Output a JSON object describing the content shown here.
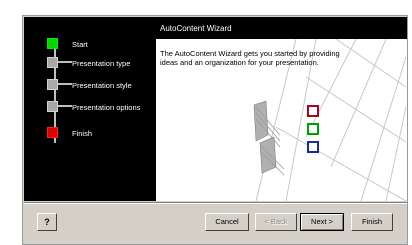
{
  "wizard": {
    "title": "AutoContent Wizard",
    "description": "The AutoContent Wizard gets you started by providing ideas and an organization for your presentation.",
    "steps": [
      {
        "label": "Start",
        "state": "current",
        "color": "#00d800"
      },
      {
        "label": "Presentation type",
        "state": "pending",
        "color": "#a8a8a8"
      },
      {
        "label": "Presentation style",
        "state": "pending",
        "color": "#a8a8a8"
      },
      {
        "label": "Presentation options",
        "state": "pending",
        "color": "#a8a8a8"
      },
      {
        "label": "Finish",
        "state": "end",
        "color": "#e00000"
      }
    ],
    "decoration_squares": [
      "red",
      "green",
      "blue"
    ]
  },
  "buttons": {
    "help_label": "?",
    "cancel_label": "Cancel",
    "back_label": "< Back",
    "next_label": "Next >",
    "finish_label": "Finish"
  }
}
